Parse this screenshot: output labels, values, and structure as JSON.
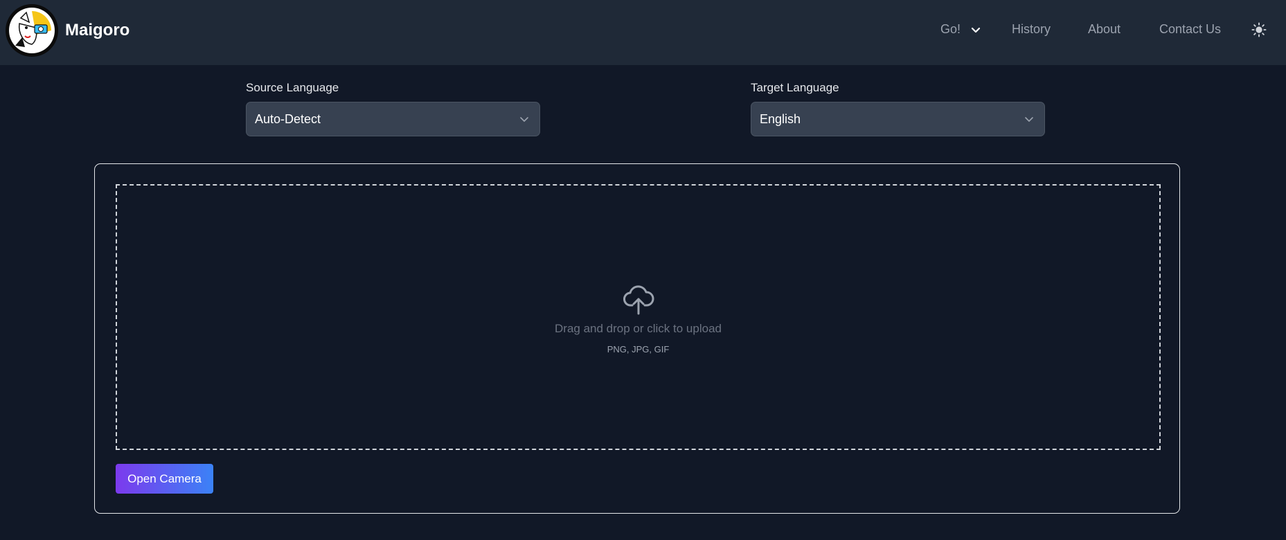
{
  "header": {
    "brand": "Maigoro",
    "nav": [
      {
        "label": "Go!",
        "icon": "chevron-down-icon"
      },
      {
        "label": "History"
      },
      {
        "label": "About"
      },
      {
        "label": "Contact Us"
      }
    ],
    "theme_icon": "sun-icon"
  },
  "languages": {
    "source": {
      "label": "Source Language",
      "value": "Auto-Detect"
    },
    "target": {
      "label": "Target Language",
      "value": "English"
    }
  },
  "upload": {
    "icon": "cloud-upload-icon",
    "prompt": "Drag and drop or click to upload",
    "formats": "PNG, JPG, GIF"
  },
  "camera_button": "Open Camera",
  "colors": {
    "background": "#111827",
    "navbar": "#1f2937",
    "select_bg": "#374151",
    "button_gradient_start": "#7c3aed",
    "button_gradient_end": "#3b82f6"
  }
}
